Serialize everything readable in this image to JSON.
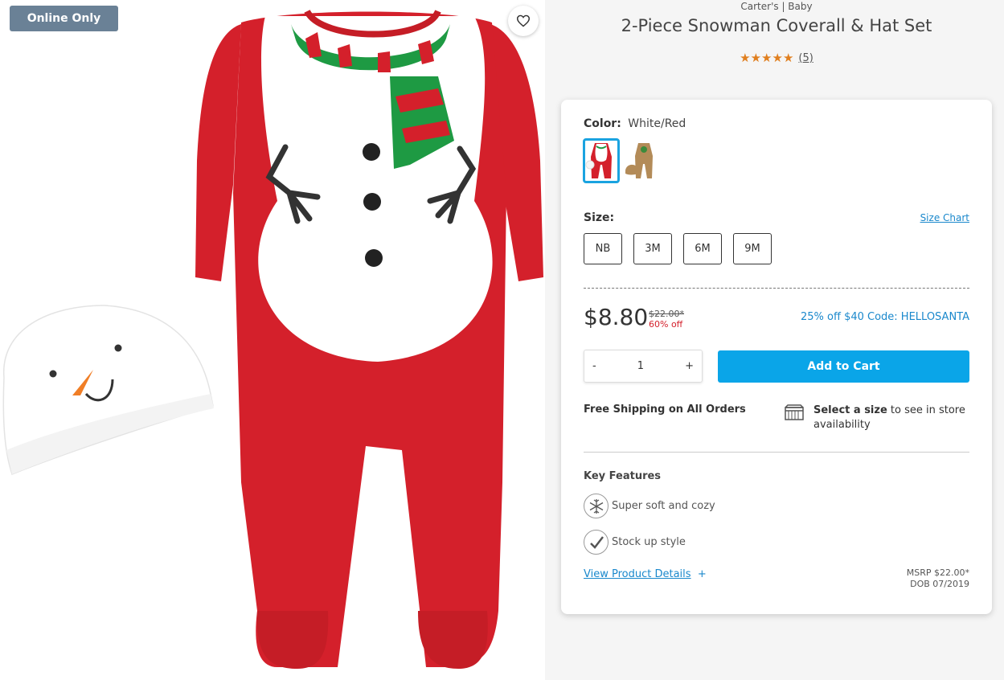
{
  "image_panel": {
    "badge": "Online Only",
    "wishlist_icon": "heart-icon"
  },
  "product": {
    "brand": "Carter's | Baby",
    "title": "2-Piece Snowman Coverall & Hat Set",
    "stars": "★★★★★",
    "rating_value": 5,
    "review_count": "(5)"
  },
  "color": {
    "label": "Color:",
    "value": "White/Red",
    "swatches": [
      "White/Red",
      "Brown"
    ]
  },
  "size": {
    "label": "Size:",
    "chart_link": "Size Chart",
    "options": [
      "NB",
      "3M",
      "6M",
      "9M"
    ]
  },
  "pricing": {
    "price": "$8.80",
    "original": "$22.00*",
    "discount": "60% off",
    "promo": "25% off $40 Code: HELLOSANTA"
  },
  "cart": {
    "minus": "-",
    "quantity": "1",
    "plus": "+",
    "add_label": "Add to Cart"
  },
  "shipping": {
    "free": "Free Shipping on All Orders",
    "store_bold": "Select a size",
    "store_rest": " to see in store availability"
  },
  "features": {
    "title": "Key Features",
    "items": [
      {
        "icon": "snowflake-icon",
        "label": "Super soft and cozy"
      },
      {
        "icon": "checkmark-icon",
        "label": "Stock up style"
      }
    ]
  },
  "details": {
    "link": "View Product Details",
    "plus": "+",
    "msrp": "MSRP $22.00*",
    "dob": "DOB 07/2019"
  },
  "colors": {
    "accent_blue": "#0aa5e8",
    "badge_bg": "#6a8196",
    "star_orange": "#e07f1f",
    "discount_red": "#d4202b",
    "link_blue": "#1a88cc"
  }
}
